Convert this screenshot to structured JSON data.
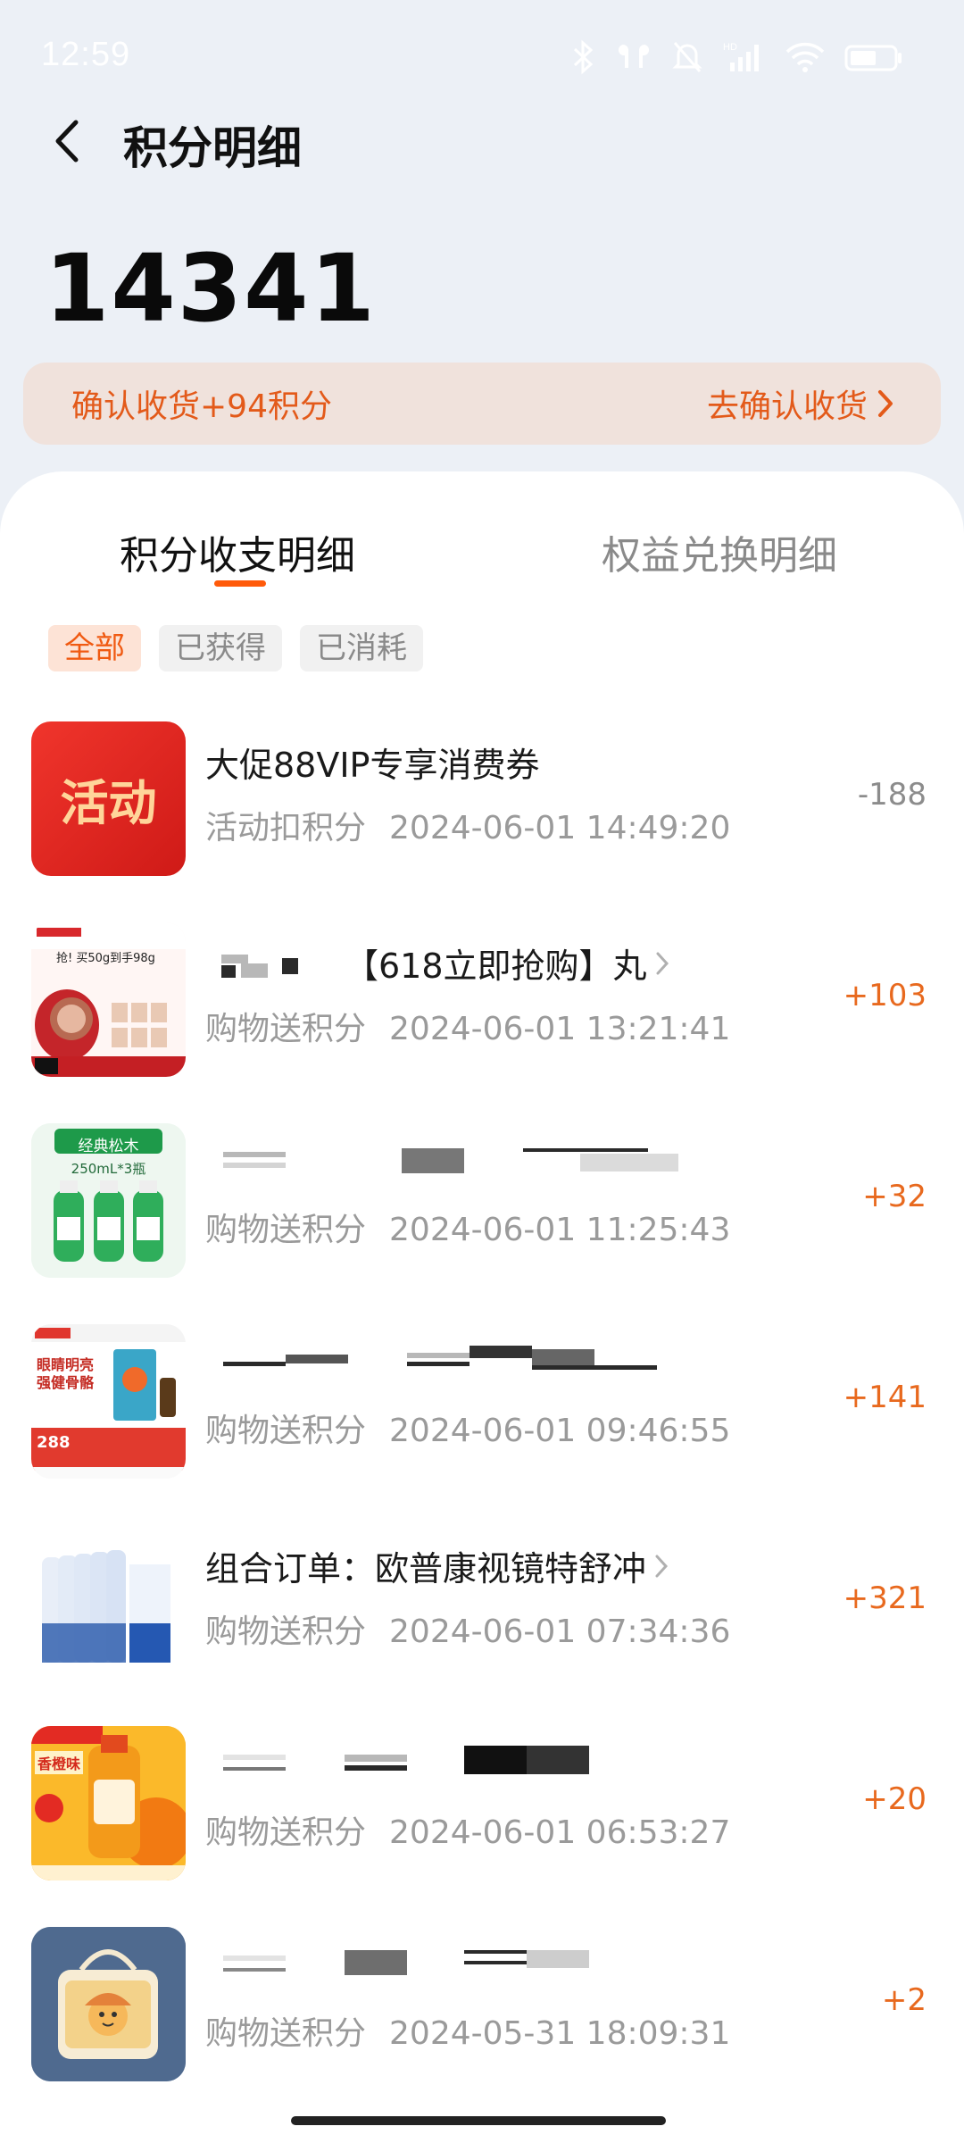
{
  "status_bar": {
    "time": "12:59"
  },
  "header": {
    "title": "积分明细"
  },
  "points": {
    "total": "14341"
  },
  "confirm_banner": {
    "text": "确认收货+94积分",
    "link_label": "去确认收货"
  },
  "tabs": [
    {
      "label": "积分收支明细",
      "active": true
    },
    {
      "label": "权益兑换明细",
      "active": false
    }
  ],
  "filters": [
    {
      "label": "全部",
      "active": true
    },
    {
      "label": "已获得",
      "active": false
    },
    {
      "label": "已消耗",
      "active": false
    }
  ],
  "records": [
    {
      "title": "大促88VIP专享消费券",
      "category": "活动扣积分",
      "datetime": "2024-06-01 14:49:20",
      "value": "-188",
      "thumb": "activity",
      "thumb_label": "活动"
    },
    {
      "title": "【618立即抢购】丸",
      "category": "购物送积分",
      "datetime": "2024-06-01 13:21:41",
      "value": "+103",
      "thumb": "cream-jars"
    },
    {
      "title": "",
      "category": "购物送积分",
      "datetime": "2024-06-01 11:25:43",
      "value": "+32",
      "thumb": "green-bottles",
      "thumb_label": "经典松木",
      "thumb_sub": "250mL*3瓶"
    },
    {
      "title": "",
      "category": "购物送积分",
      "datetime": "2024-06-01 09:46:55",
      "value": "+141",
      "thumb": "vitamin",
      "thumb_label": "眼睛明亮 强健骨骼",
      "thumb_price": "288"
    },
    {
      "title": "组合订单：欧普康视镜特舒冲",
      "category": "购物送积分",
      "datetime": "2024-06-01 07:34:36",
      "value": "+321",
      "thumb": "lens-solution"
    },
    {
      "title": "",
      "category": "购物送积分",
      "datetime": "2024-06-01 06:53:27",
      "value": "+20",
      "thumb": "orange-cleaner",
      "thumb_label": "香橙味"
    },
    {
      "title": "",
      "category": "购物送积分",
      "datetime": "2024-05-31 18:09:31",
      "value": "+2",
      "thumb": "bag-cartoon"
    }
  ],
  "colors": {
    "accent": "#e8691e",
    "banner_bg": "#f0e2dc",
    "chip_active_bg": "#fde3d6",
    "page_bg": "#ecf0f6"
  }
}
